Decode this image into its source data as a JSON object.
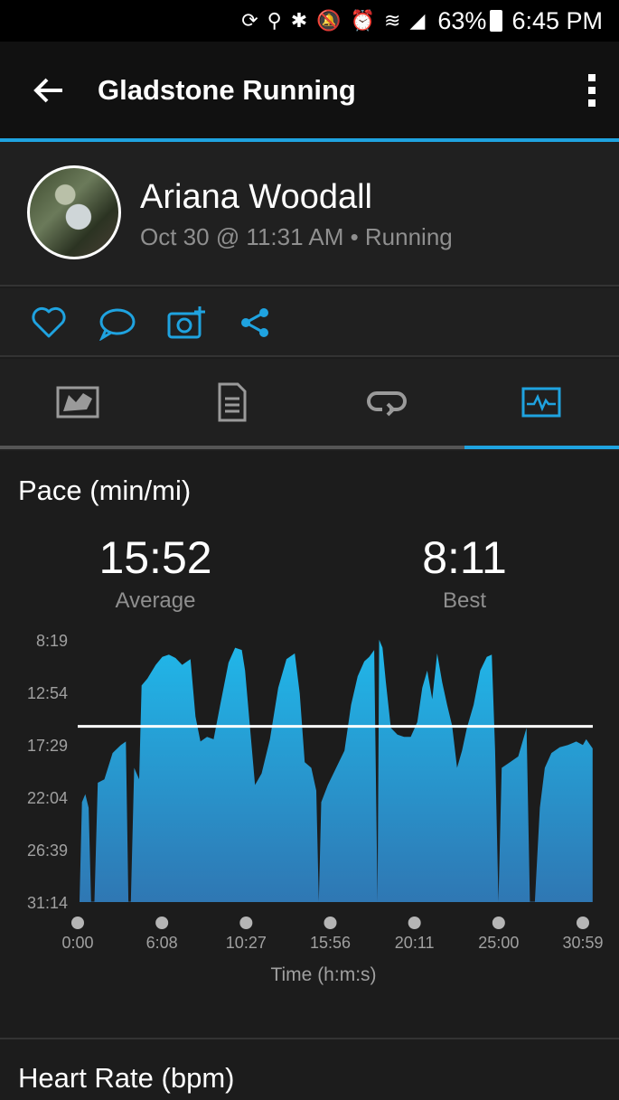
{
  "status_bar": {
    "battery": "63%",
    "time": "6:45 PM",
    "icons": [
      "sync-icon",
      "location-icon",
      "bluetooth-icon",
      "mute-icon",
      "alarm-icon",
      "wifi-icon",
      "signal-icon"
    ]
  },
  "app_bar": {
    "title": "Gladstone Running",
    "back_icon": "arrow-left-icon",
    "more_icon": "more-vertical-icon"
  },
  "profile": {
    "name": "Ariana Woodall",
    "meta": "Oct 30 @ 11:31 AM • Running"
  },
  "actions": [
    "like-icon",
    "comment-icon",
    "add-photo-icon",
    "share-icon"
  ],
  "tabs": [
    {
      "icon": "map-icon",
      "active": false
    },
    {
      "icon": "details-icon",
      "active": false
    },
    {
      "icon": "laps-icon",
      "active": false
    },
    {
      "icon": "charts-icon",
      "active": true
    }
  ],
  "colors": {
    "accent": "#1fa3e0",
    "chart_top": "#20b8ea",
    "chart_bottom": "#2f77b3",
    "background": "#1c1c1c"
  },
  "pace": {
    "title": "Pace (min/mi)",
    "average_value": "15:52",
    "average_label": "Average",
    "best_value": "8:11",
    "best_label": "Best"
  },
  "chart_data": {
    "type": "area",
    "title": "Pace (min/mi)",
    "xlabel": "Time (h:m:s)",
    "ylabel": "",
    "x_ticks": [
      "0:00",
      "6:08",
      "10:27",
      "15:56",
      "20:11",
      "25:00",
      "30:59"
    ],
    "y_ticks": [
      "8:19",
      "12:54",
      "17:29",
      "22:04",
      "26:39",
      "31:14"
    ],
    "ylim_minutes": [
      8.32,
      31.23
    ],
    "x_range_minutes": [
      0,
      31
    ],
    "inverted_y": true,
    "average_line_minutes": 15.87,
    "series": [
      {
        "values_minutes": [
          [
            0.0,
            31.2
          ],
          [
            0.15,
            22.5
          ],
          [
            0.35,
            21.8
          ],
          [
            0.55,
            23.0
          ],
          [
            0.7,
            31.2
          ],
          [
            0.9,
            31.2
          ],
          [
            1.1,
            20.8
          ],
          [
            1.5,
            20.5
          ],
          [
            2.0,
            18.2
          ],
          [
            2.5,
            17.5
          ],
          [
            2.8,
            17.2
          ],
          [
            2.95,
            31.2
          ],
          [
            3.1,
            31.2
          ],
          [
            3.3,
            19.5
          ],
          [
            3.6,
            20.5
          ],
          [
            3.75,
            12.3
          ],
          [
            4.1,
            11.7
          ],
          [
            4.6,
            10.5
          ],
          [
            5.0,
            9.8
          ],
          [
            5.4,
            9.6
          ],
          [
            5.8,
            9.9
          ],
          [
            6.2,
            10.5
          ],
          [
            6.5,
            10.2
          ],
          [
            6.7,
            10.0
          ],
          [
            7.0,
            15.0
          ],
          [
            7.3,
            17.2
          ],
          [
            7.7,
            16.8
          ],
          [
            8.1,
            17.0
          ],
          [
            8.5,
            14.0
          ],
          [
            9.0,
            10.3
          ],
          [
            9.4,
            9.0
          ],
          [
            9.8,
            9.2
          ],
          [
            10.0,
            11.0
          ],
          [
            10.3,
            16.0
          ],
          [
            10.6,
            21.0
          ],
          [
            11.0,
            20.0
          ],
          [
            11.5,
            17.0
          ],
          [
            12.0,
            12.5
          ],
          [
            12.5,
            10.0
          ],
          [
            13.0,
            9.5
          ],
          [
            13.3,
            13.0
          ],
          [
            13.6,
            19.0
          ],
          [
            14.0,
            19.5
          ],
          [
            14.3,
            21.5
          ],
          [
            14.45,
            31.2
          ],
          [
            14.6,
            22.5
          ],
          [
            15.0,
            21.0
          ],
          [
            15.5,
            19.5
          ],
          [
            16.0,
            18.0
          ],
          [
            16.4,
            14.0
          ],
          [
            16.8,
            11.5
          ],
          [
            17.2,
            10.2
          ],
          [
            17.5,
            9.8
          ],
          [
            17.8,
            9.2
          ],
          [
            18.0,
            31.2
          ],
          [
            18.1,
            8.3
          ],
          [
            18.3,
            9.0
          ],
          [
            18.5,
            12.0
          ],
          [
            18.8,
            16.0
          ],
          [
            19.2,
            16.6
          ],
          [
            19.6,
            16.8
          ],
          [
            20.0,
            16.8
          ],
          [
            20.4,
            15.5
          ],
          [
            20.7,
            12.5
          ],
          [
            21.0,
            11.0
          ],
          [
            21.3,
            13.5
          ],
          [
            21.6,
            9.5
          ],
          [
            21.9,
            12.0
          ],
          [
            22.2,
            14.0
          ],
          [
            22.5,
            15.8
          ],
          [
            22.8,
            19.5
          ],
          [
            23.1,
            18.0
          ],
          [
            23.4,
            16.0
          ],
          [
            23.8,
            14.0
          ],
          [
            24.2,
            11.0
          ],
          [
            24.6,
            9.8
          ],
          [
            24.9,
            9.6
          ],
          [
            25.1,
            18.0
          ],
          [
            25.3,
            31.2
          ],
          [
            25.5,
            19.5
          ],
          [
            26.0,
            19.0
          ],
          [
            26.5,
            18.5
          ],
          [
            27.0,
            16.0
          ],
          [
            27.2,
            31.2
          ],
          [
            27.5,
            31.2
          ],
          [
            27.8,
            23.0
          ],
          [
            28.1,
            19.5
          ],
          [
            28.5,
            18.2
          ],
          [
            29.0,
            17.7
          ],
          [
            29.5,
            17.5
          ],
          [
            30.0,
            17.2
          ],
          [
            30.4,
            17.5
          ],
          [
            30.6,
            17.0
          ],
          [
            30.99,
            17.8
          ]
        ]
      }
    ]
  },
  "heart_rate": {
    "title": "Heart Rate (bpm)"
  }
}
